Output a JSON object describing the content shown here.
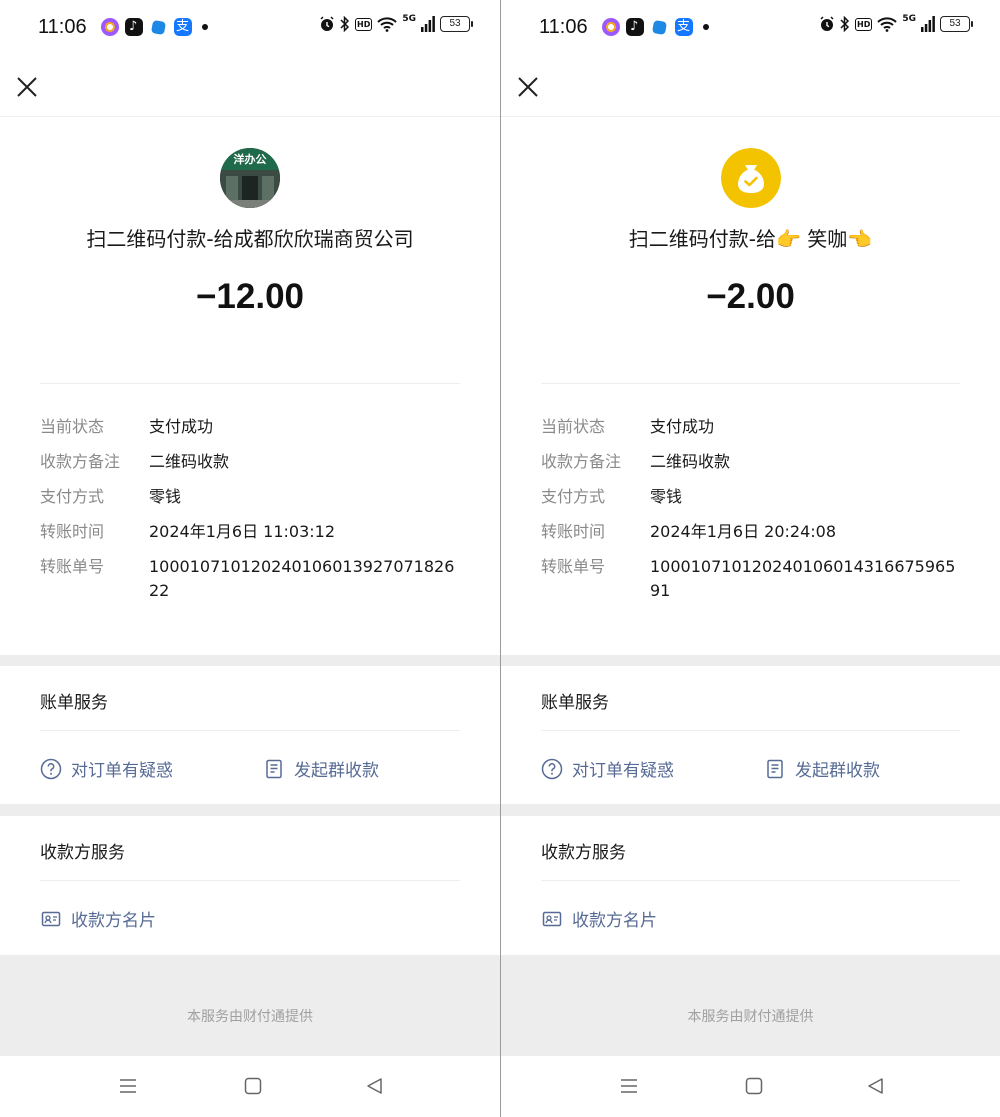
{
  "statusBar": {
    "time": "11:06",
    "battery": "53",
    "network": "5G",
    "hd": "HD"
  },
  "shared": {
    "labels": {
      "status": "当前状态",
      "remark": "收款方备注",
      "method": "支付方式",
      "time": "转账时间",
      "number": "转账单号"
    },
    "billService": {
      "title": "账单服务",
      "question": "对订单有疑惑",
      "group": "发起群收款"
    },
    "payeeService": {
      "title": "收款方服务",
      "card": "收款方名片"
    },
    "footer": "本服务由财付通提供"
  },
  "screens": [
    {
      "avatarText": "洋办公",
      "merchant": "扫二维码付款-给成都欣欣瑞商贸公司",
      "amount": "−12.00",
      "status": "支付成功",
      "remark": "二维码收款",
      "method": "零钱",
      "time": "2024年1月6日 11:03:12",
      "number": "10001071012024010601392707182622"
    },
    {
      "merchant": "扫二维码付款-给👉 笑咖👈",
      "amount": "−2.00",
      "status": "支付成功",
      "remark": "二维码收款",
      "method": "零钱",
      "time": "2024年1月6日 20:24:08",
      "number": "10001071012024010601431667596591"
    }
  ],
  "colors": {
    "link": "#576b95",
    "bagYellow": "#f3c300",
    "background": "#ededed"
  }
}
